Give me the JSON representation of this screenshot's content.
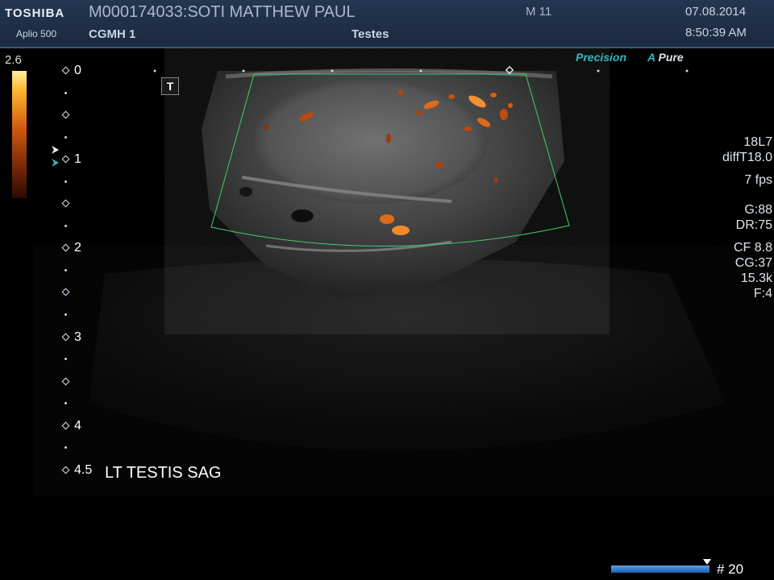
{
  "header": {
    "brand": "TOSHIBA",
    "model": "Aplio 500",
    "patient": "M000174033:SOTI MATTHEW PAUL",
    "hospital": "CGMH 1",
    "mode": "M 11",
    "exam": "Testes",
    "date": "07.08.2014",
    "time": "8:50:39 AM"
  },
  "colorbar": {
    "max": "2.6",
    "colors": [
      "#fff0a0",
      "#ffb830",
      "#d05a10",
      "#7a2808",
      "#2a0a02"
    ]
  },
  "depth_scale": [
    "0",
    "1",
    "2",
    "3",
    "4",
    "4.5"
  ],
  "badges": {
    "precision": "Precision",
    "apure_a": "A",
    "apure_rest": "Pure"
  },
  "t_marker": "T",
  "params": {
    "probe": "18L7",
    "preset": "diffT18.0",
    "fps": "7 fps",
    "gain": "G:88",
    "dr": "DR:75",
    "cf": "CF 8.8",
    "cg": "CG:37",
    "prf": "15.3k",
    "filter": "F:4"
  },
  "annotation": "LT TESTIS SAG",
  "cine": {
    "frame": "# 20"
  },
  "accent_colors": {
    "roi": "#3fcf6a",
    "doppler": "#e06a18",
    "header": "#1e2f48"
  }
}
